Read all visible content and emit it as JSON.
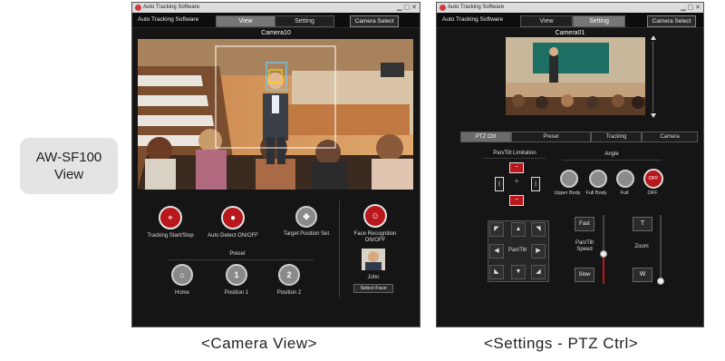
{
  "side_label": {
    "line1": "AW-SF100",
    "line2": "View"
  },
  "captions": {
    "left": "<Camera View>",
    "right": "<Settings - PTZ Ctrl>"
  },
  "camera_view": {
    "window_title": "Auto Tracking Software",
    "app_name": "Auto Tracking Software",
    "tabs": [
      "View",
      "Setting"
    ],
    "active_tab": "View",
    "camera_select": "Camera Select",
    "camera_label": "Camera10",
    "controls": [
      {
        "label": "Tracking Start/Stop",
        "icon": "crosshair-icon"
      },
      {
        "label": "Auto Detect ON/OFF",
        "icon": "person-icon"
      },
      {
        "label": "Target Position Set",
        "icon": "target-position-icon"
      },
      {
        "label": "Face Recognition ON/OFF",
        "icon": "face-recognition-icon"
      }
    ],
    "preset": {
      "title": "Preset",
      "items": [
        {
          "label": "Home",
          "symbol": "⌂"
        },
        {
          "label": "Position 1",
          "symbol": "1"
        },
        {
          "label": "Position 2",
          "symbol": "2"
        }
      ]
    },
    "face": {
      "name": "John",
      "select_label": "Select Face"
    }
  },
  "settings_view": {
    "window_title": "Auto Tracking Software",
    "app_name": "Auto Tracking Software",
    "tabs": [
      "View",
      "Setting"
    ],
    "active_tab": "Setting",
    "camera_select": "Camera Select",
    "camera_label": "Camera01",
    "subtabs": [
      "PTZ Ctrl",
      "Preset",
      "Tracking",
      "Camera"
    ],
    "active_subtab": "PTZ Ctrl",
    "pan_tilt_limitation": "Pan/Tilt Limitation",
    "angle": {
      "title": "Angle",
      "options": [
        "Upper Body",
        "Full Body",
        "Full",
        "OFF"
      ],
      "selected": "OFF"
    },
    "pan_tilt_pad": "Pan/Tilt",
    "speed": {
      "title": "Pan/Tilt Speed",
      "fast": "Fast",
      "slow": "Slow",
      "level": 0.45
    },
    "zoom": {
      "title": "Zoom",
      "tele": "T",
      "wide": "W",
      "level": 0.05
    }
  },
  "colors": {
    "accent_red": "#b8171b",
    "dark_bg": "#151515",
    "panel_grey": "#8a8a8a"
  }
}
